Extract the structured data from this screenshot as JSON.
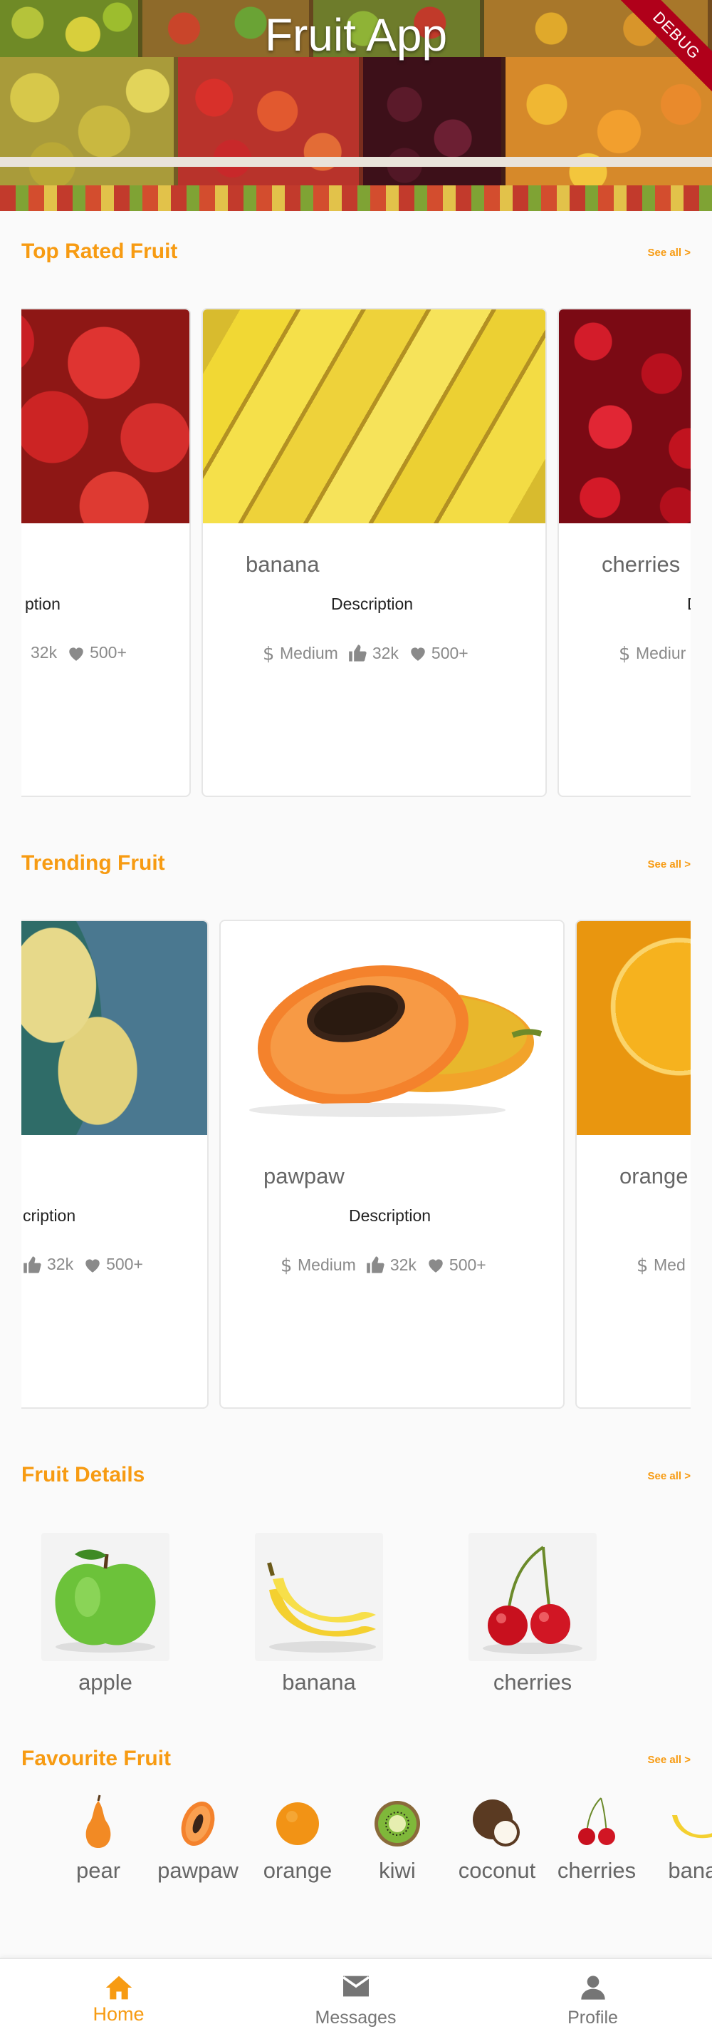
{
  "app": {
    "title": "Fruit App",
    "debug_banner": "DEBUG"
  },
  "sections": {
    "top_rated": {
      "title": "Top Rated Fruit",
      "see_all": "See all >"
    },
    "trending": {
      "title": "Trending Fruit",
      "see_all": "See all >"
    },
    "details": {
      "title": "Fruit Details",
      "see_all": "See all >"
    },
    "favourite": {
      "title": "Favourite Fruit",
      "see_all": "See all >"
    }
  },
  "top_rated_cards": [
    {
      "name": "",
      "description": "ption",
      "price_label": "",
      "likes": "32k",
      "favs": "500+"
    },
    {
      "name": "banana",
      "description": "Description",
      "price_label": "Medium",
      "likes": "32k",
      "favs": "500+"
    },
    {
      "name": "cherries",
      "description": "D",
      "price_label": "Mediur",
      "likes": "",
      "favs": ""
    }
  ],
  "trending_cards": [
    {
      "name": "",
      "description": "cription",
      "price_label": "",
      "likes": "32k",
      "favs": "500+"
    },
    {
      "name": "pawpaw",
      "description": "Description",
      "price_label": "Medium",
      "likes": "32k",
      "favs": "500+"
    },
    {
      "name": "orange",
      "description": "",
      "price_label": "Med",
      "likes": "",
      "favs": ""
    }
  ],
  "details_items": [
    {
      "label": "apple"
    },
    {
      "label": "banana"
    },
    {
      "label": "cherries"
    }
  ],
  "favourite_items": [
    {
      "label": "pear"
    },
    {
      "label": "pawpaw"
    },
    {
      "label": "orange"
    },
    {
      "label": "kiwi"
    },
    {
      "label": "coconut"
    },
    {
      "label": "cherries"
    },
    {
      "label": "banar"
    }
  ],
  "bottom_nav": {
    "home": "Home",
    "messages": "Messages",
    "profile": "Profile"
  },
  "colors": {
    "accent": "#f79b12",
    "muted": "#8a8a8a"
  }
}
